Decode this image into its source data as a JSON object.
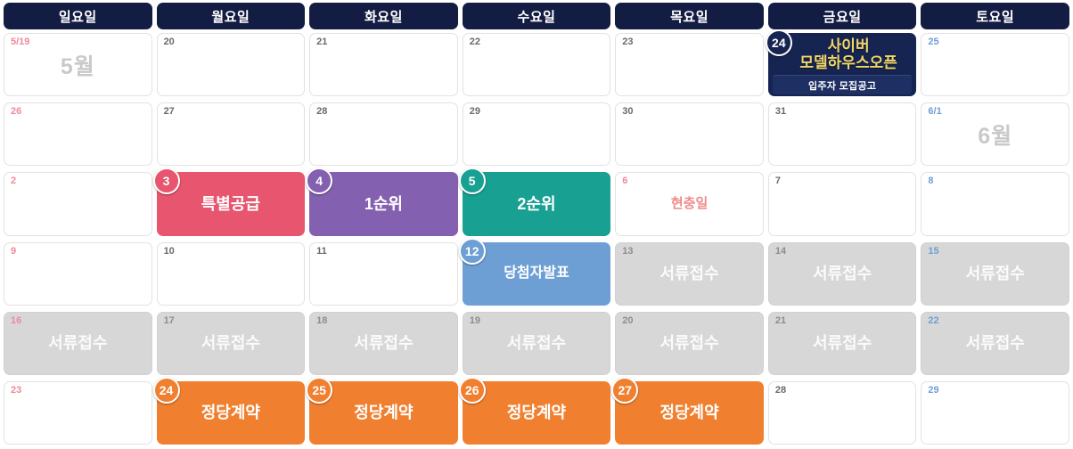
{
  "header": {
    "days": [
      "일요일",
      "월요일",
      "화요일",
      "수요일",
      "목요일",
      "금요일",
      "토요일"
    ]
  },
  "colors": {
    "header_bg": "#131c42",
    "pink": "#e8556e",
    "purple": "#8460b0",
    "teal": "#18a092",
    "blue": "#6e9fd4",
    "orange": "#f08030",
    "gray": "#d7d7d7",
    "navy": "#152451",
    "promo_gold": "#f3d66a",
    "sunday_text": "#f1889a",
    "saturday_text": "#6e9fd4",
    "month_watermark": "#c9c9c9"
  },
  "weeks": [
    [
      {
        "date": "5/19",
        "date_style": "sun",
        "label": "5월",
        "kind": "month"
      },
      {
        "date": "20",
        "date_style": "plain",
        "label": "",
        "kind": "empty"
      },
      {
        "date": "21",
        "date_style": "plain",
        "label": "",
        "kind": "empty"
      },
      {
        "date": "22",
        "date_style": "plain",
        "label": "",
        "kind": "empty"
      },
      {
        "date": "23",
        "date_style": "plain",
        "label": "",
        "kind": "empty"
      },
      {
        "date": "24",
        "date_style": "badge",
        "label": "사이버\n모델하우스오픈",
        "sublabel": "입주자 모집공고",
        "kind": "promo",
        "color": "navy"
      },
      {
        "date": "25",
        "date_style": "sat",
        "label": "",
        "kind": "empty"
      }
    ],
    [
      {
        "date": "26",
        "date_style": "sun",
        "label": "",
        "kind": "empty"
      },
      {
        "date": "27",
        "date_style": "plain",
        "label": "",
        "kind": "empty"
      },
      {
        "date": "28",
        "date_style": "plain",
        "label": "",
        "kind": "empty"
      },
      {
        "date": "29",
        "date_style": "plain",
        "label": "",
        "kind": "empty"
      },
      {
        "date": "30",
        "date_style": "plain",
        "label": "",
        "kind": "empty"
      },
      {
        "date": "31",
        "date_style": "plain",
        "label": "",
        "kind": "empty"
      },
      {
        "date": "6/1",
        "date_style": "sat",
        "label": "6월",
        "kind": "month"
      }
    ],
    [
      {
        "date": "2",
        "date_style": "sun",
        "label": "",
        "kind": "empty"
      },
      {
        "date": "3",
        "date_style": "badge",
        "label": "특별공급",
        "kind": "event",
        "color": "pink"
      },
      {
        "date": "4",
        "date_style": "badge",
        "label": "1순위",
        "kind": "event",
        "color": "purple"
      },
      {
        "date": "5",
        "date_style": "badge",
        "label": "2순위",
        "kind": "event",
        "color": "teal"
      },
      {
        "date": "6",
        "date_style": "hol",
        "label": "현충일",
        "kind": "holiday"
      },
      {
        "date": "7",
        "date_style": "plain",
        "label": "",
        "kind": "empty"
      },
      {
        "date": "8",
        "date_style": "sat",
        "label": "",
        "kind": "empty"
      }
    ],
    [
      {
        "date": "9",
        "date_style": "sun",
        "label": "",
        "kind": "empty"
      },
      {
        "date": "10",
        "date_style": "plain",
        "label": "",
        "kind": "empty"
      },
      {
        "date": "11",
        "date_style": "plain",
        "label": "",
        "kind": "empty"
      },
      {
        "date": "12",
        "date_style": "badge",
        "label": "당첨자발표",
        "kind": "event",
        "color": "blue"
      },
      {
        "date": "13",
        "date_style": "ongray",
        "label": "서류접수",
        "kind": "event",
        "color": "gray"
      },
      {
        "date": "14",
        "date_style": "ongray",
        "label": "서류접수",
        "kind": "event",
        "color": "gray"
      },
      {
        "date": "15",
        "date_style": "sat",
        "label": "서류접수",
        "kind": "event",
        "color": "gray"
      }
    ],
    [
      {
        "date": "16",
        "date_style": "sun",
        "label": "서류접수",
        "kind": "event",
        "color": "gray"
      },
      {
        "date": "17",
        "date_style": "ongray",
        "label": "서류접수",
        "kind": "event",
        "color": "gray"
      },
      {
        "date": "18",
        "date_style": "ongray",
        "label": "서류접수",
        "kind": "event",
        "color": "gray"
      },
      {
        "date": "19",
        "date_style": "ongray",
        "label": "서류접수",
        "kind": "event",
        "color": "gray"
      },
      {
        "date": "20",
        "date_style": "ongray",
        "label": "서류접수",
        "kind": "event",
        "color": "gray"
      },
      {
        "date": "21",
        "date_style": "ongray",
        "label": "서류접수",
        "kind": "event",
        "color": "gray"
      },
      {
        "date": "22",
        "date_style": "sat",
        "label": "서류접수",
        "kind": "event",
        "color": "gray"
      }
    ],
    [
      {
        "date": "23",
        "date_style": "sun",
        "label": "",
        "kind": "empty"
      },
      {
        "date": "24",
        "date_style": "badge",
        "label": "정당계약",
        "kind": "event",
        "color": "orange"
      },
      {
        "date": "25",
        "date_style": "badge",
        "label": "정당계약",
        "kind": "event",
        "color": "orange"
      },
      {
        "date": "26",
        "date_style": "badge",
        "label": "정당계약",
        "kind": "event",
        "color": "orange"
      },
      {
        "date": "27",
        "date_style": "badge",
        "label": "정당계약",
        "kind": "event",
        "color": "orange"
      },
      {
        "date": "28",
        "date_style": "plain",
        "label": "",
        "kind": "empty"
      },
      {
        "date": "29",
        "date_style": "sat",
        "label": "",
        "kind": "empty"
      }
    ]
  ]
}
